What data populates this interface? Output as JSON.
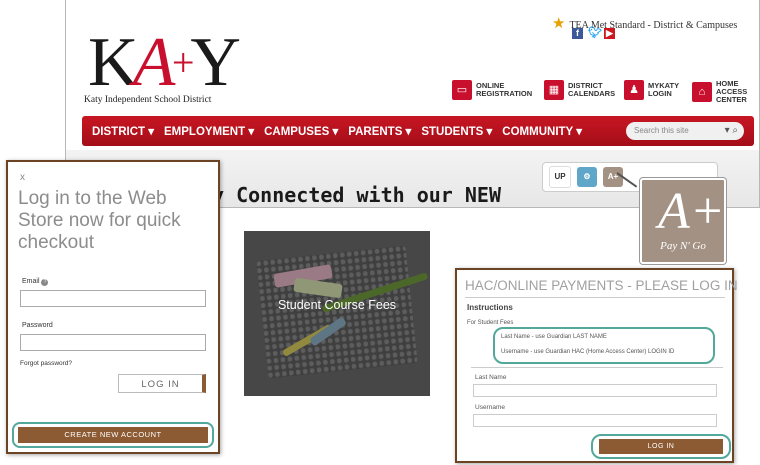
{
  "site": {
    "logo": {
      "k": "K",
      "a": "A",
      "y": "Y",
      "subtitle": "Katy Independent School District"
    },
    "tea_text": "TEA Met Standard - District & Campuses",
    "social": [
      {
        "icon": "facebook-icon",
        "glyph": "f",
        "color": "#3b5998"
      },
      {
        "icon": "twitter-icon",
        "glyph": "t",
        "color": "#1da1f2"
      },
      {
        "icon": "youtube-icon",
        "glyph": "▶",
        "color": "#cc181e"
      }
    ],
    "quick_links": [
      {
        "label": "ONLINE REGISTRATION",
        "icon": "monitor-icon",
        "glyph": "▭"
      },
      {
        "label": "DISTRICT CALENDARS",
        "icon": "calendar-icon",
        "glyph": "▦"
      },
      {
        "label": "MYKATY LOGIN",
        "icon": "user-icon",
        "glyph": "♟"
      },
      {
        "label": "HOME ACCESS CENTER",
        "icon": "home-icon",
        "glyph": "⌂"
      }
    ],
    "nav": [
      "DISTRICT ▾",
      "EMPLOYMENT ▾",
      "CAMPUSES ▾",
      "PARENTS ▾",
      "STUDENTS ▾",
      "COMMUNITY ▾"
    ],
    "search_placeholder": "Search this site",
    "search_glyph": "▾ ⌕",
    "headline": "y Connected with our NEW",
    "strip_icons": [
      {
        "icon": "up-app-icon",
        "text": "UP",
        "color": "#e9a21a"
      },
      {
        "icon": "app-icon",
        "text": "⚙",
        "color": "#5fa6c8"
      },
      {
        "icon": "pay-n-go-icon",
        "text": "A+",
        "color": "#a39283"
      }
    ]
  },
  "paygo": {
    "big": "A+",
    "caption": "Pay N' Go"
  },
  "login": {
    "close": "x",
    "title": "Log in to the Web Store now for quick checkout",
    "email_label": "Email",
    "password_label": "Password",
    "forgot": "Forgot password?",
    "login_button": "LOG IN",
    "create_button": "CREATE NEW ACCOUNT"
  },
  "fees": {
    "label": "Student Course Fees"
  },
  "hac": {
    "title": "HAC/ONLINE PAYMENTS - PLEASE LOG IN",
    "instructions": "Instructions",
    "for_students": "For Student Fees",
    "line1": "Last Name - use Guardian LAST NAME",
    "line2": "Username - use Guardian HAC (Home Access Center) LOGIN ID",
    "last_name_label": "Last Name",
    "username_label": "Username",
    "login_button": "LOG IN"
  }
}
